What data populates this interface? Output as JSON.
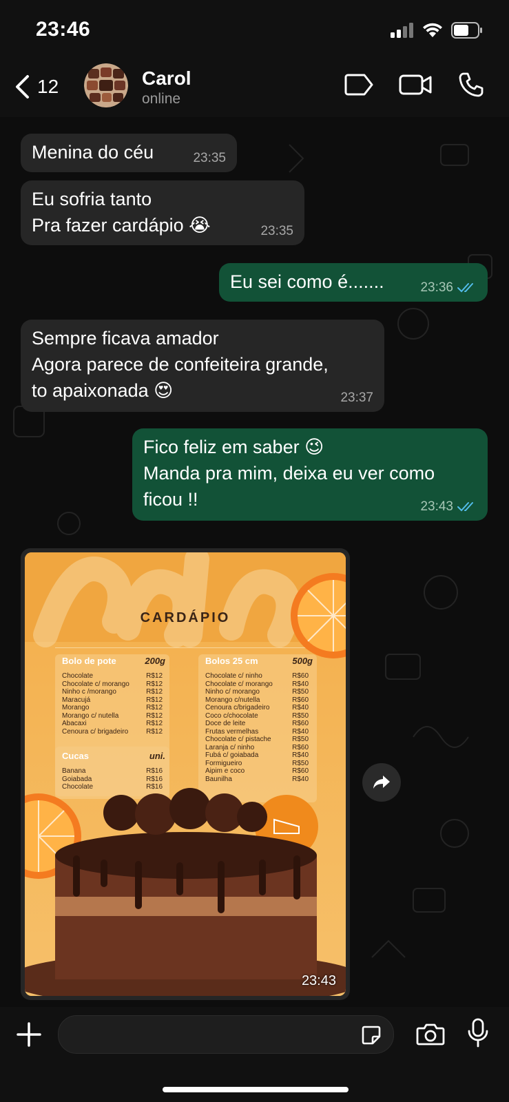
{
  "status_bar": {
    "time": "23:46"
  },
  "header": {
    "back_count": "12",
    "contact_name": "Carol",
    "contact_status": "online"
  },
  "messages": [
    {
      "dir": "in",
      "lines": [
        "Menina do céu"
      ],
      "time": "23:35"
    },
    {
      "dir": "in",
      "lines": [
        "Eu sofria tanto",
        "Pra fazer cardápio 😭"
      ],
      "time": "23:35"
    },
    {
      "dir": "out",
      "lines": [
        "Eu sei como é......."
      ],
      "time": "23:36",
      "read": true
    },
    {
      "dir": "in",
      "lines": [
        "Sempre ficava amador",
        "Agora parece de confeiteira grande,",
        "to apaixonada 😍"
      ],
      "time": "23:37"
    },
    {
      "dir": "out",
      "lines": [
        "Fico feliz em saber 😉",
        "Manda pra mim, deixa eu ver como",
        "ficou !!"
      ],
      "time": "23:43",
      "read": true
    }
  ],
  "image_message": {
    "time": "23:43",
    "menu": {
      "title": "CARDÁPIO",
      "section1": {
        "name": "Bolo de pote",
        "size": "200g",
        "items": [
          [
            "Chocolate",
            "R$12"
          ],
          [
            "Chocolate c/ morango",
            "R$12"
          ],
          [
            "Ninho c /morango",
            "R$12"
          ],
          [
            "Maracujá",
            "R$12"
          ],
          [
            "Morango",
            "R$12"
          ],
          [
            "Morango c/ nutella",
            "R$12"
          ],
          [
            "Abacaxi",
            "R$12"
          ],
          [
            "Cenoura c/ brigadeiro",
            "R$12"
          ]
        ]
      },
      "section2": {
        "name": "Cucas",
        "size": "uni.",
        "items": [
          [
            "Banana",
            "R$16"
          ],
          [
            "Goiabada",
            "R$16"
          ],
          [
            "Chocolate",
            "R$16"
          ]
        ]
      },
      "section3": {
        "name": "Bolos 25 cm",
        "size": "500g",
        "items": [
          [
            "Chocolate c/ ninho",
            "R$60"
          ],
          [
            "Chocolate c/ morango",
            "R$40"
          ],
          [
            "Ninho c/ morango",
            "R$50"
          ],
          [
            "Morango c/nutella",
            "R$60"
          ],
          [
            "Cenoura c/brigadeiro",
            "R$40"
          ],
          [
            "Coco c/chocolate",
            "R$50"
          ],
          [
            "Doce de leite",
            "R$60"
          ],
          [
            "Frutas vermelhas",
            "R$40"
          ],
          [
            "Chocolate c/ pistache",
            "R$50"
          ],
          [
            "Laranja c/ ninho",
            "R$60"
          ],
          [
            "Fubá c/ goiabada",
            "R$40"
          ],
          [
            "Formigueiro",
            "R$50"
          ],
          [
            "Aipim e coco",
            "R$60"
          ],
          [
            "Baunilha",
            "R$40"
          ]
        ]
      }
    }
  },
  "input": {
    "placeholder": ""
  },
  "colors": {
    "incoming": "#262626",
    "outgoing": "#125237",
    "read_ticks": "#53bdeb"
  }
}
